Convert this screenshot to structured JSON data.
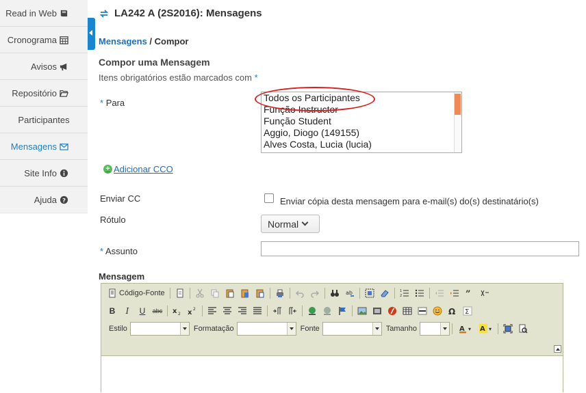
{
  "sidebar": {
    "items": [
      {
        "label": "Read in Web",
        "icon": "book-icon"
      },
      {
        "label": "Cronograma",
        "icon": "calendar-icon"
      },
      {
        "label": "Avisos",
        "icon": "bullhorn-icon"
      },
      {
        "label": "Repositório",
        "icon": "folder-open-icon"
      },
      {
        "label": "Participantes",
        "icon": ""
      },
      {
        "label": "Mensagens",
        "icon": "envelope-icon",
        "active": true
      },
      {
        "label": "Site Info",
        "icon": "info-icon"
      },
      {
        "label": "Ajuda",
        "icon": "question-icon"
      }
    ]
  },
  "header": {
    "title": "LA242 A (2S2016): Mensagens"
  },
  "breadcrumb": {
    "parent": "Mensagens",
    "separator": " / ",
    "current": "Compor"
  },
  "form": {
    "heading": "Compor uma Mensagem",
    "required_note": "Itens obrigatórios estão marcados com",
    "required_marker": "*",
    "to_label": "Para",
    "recipients": [
      "Todos os Participantes",
      "Função Instructor",
      "Função Student",
      "Aggio, Diogo (149155)",
      "Alves Costa, Lucia (lucia)"
    ],
    "add_bcc": "Adicionar CCO",
    "cc_label": "Enviar CC",
    "cc_text": "Enviar cópia desta mensagem para e-mail(s) do(s) destinatário(s)",
    "tag_label": "Rótulo",
    "tag_value": "Normal",
    "subject_label": "Assunto",
    "subject_value": "",
    "message_label": "Mensagem"
  },
  "editor": {
    "source_label": "Código-Fonte",
    "style_label": "Estilo",
    "format_label": "Formatação",
    "font_label": "Fonte",
    "size_label": "Tamanho",
    "bold": "B",
    "italic": "I",
    "underline": "U",
    "strike": "abc"
  },
  "colors": {
    "accent": "#1f7fc1",
    "highlight": "#d9201f",
    "editor_bg": "#e3e4cf"
  }
}
